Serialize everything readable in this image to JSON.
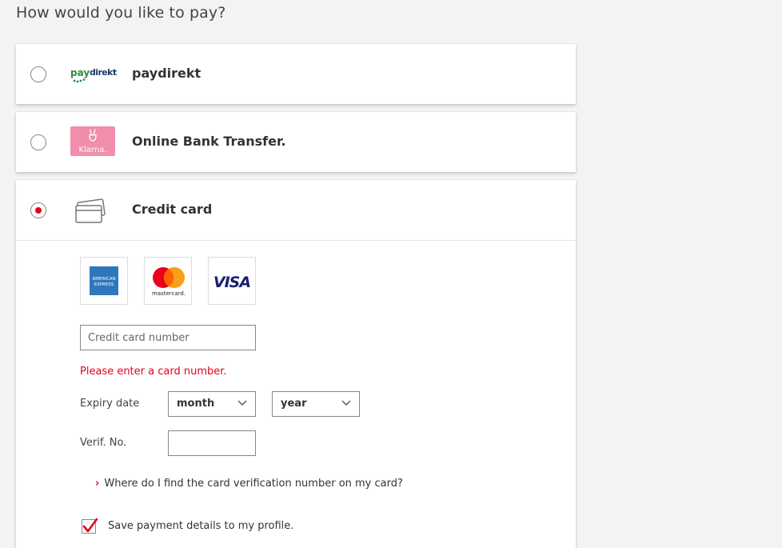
{
  "heading": "How would you like to pay?",
  "methods": {
    "paydirekt": {
      "label": "paydirekt",
      "logo_text_pay": "pay",
      "logo_text_direkt": "direkt",
      "selected": false
    },
    "klarna": {
      "label": "Online Bank Transfer.",
      "logo_text": "Klarna.",
      "selected": false
    },
    "credit_card": {
      "label": "Credit card",
      "selected": true
    }
  },
  "card_brands": {
    "amex_line1": "AMERICAN",
    "amex_line2": "EXPRESS",
    "mastercard_text": "mastercard.",
    "visa_text": "VISA"
  },
  "form": {
    "card_number_placeholder": "Credit card number",
    "card_number_value": "",
    "error_text": "Please enter a card number.",
    "expiry_label": "Expiry date",
    "month_value": "month",
    "year_value": "year",
    "verif_label": "Verif. No.",
    "verif_value": "",
    "help_link_text": "Where do I find the card verification number on my card?",
    "help_arrow": "›",
    "save_label": "Save payment details to my profile.",
    "save_checked": true
  },
  "colors": {
    "accent": "#e2001a",
    "klarna_pink": "#f08eab",
    "paydirekt_green": "#2e8b3e",
    "paydirekt_navy": "#1b3a6b",
    "amex_blue": "#2e77bc",
    "visa_blue": "#1a1f71",
    "mastercard_red": "#eb001b",
    "mastercard_orange": "#f79e1b"
  },
  "icons": {
    "credit_card_method": "credit-card-icon",
    "klarna_hand": "peace-hand-icon",
    "select_chevron": "chevron-down-icon",
    "help_arrow": "chevron-right-icon",
    "save_check": "checkmark-icon"
  }
}
